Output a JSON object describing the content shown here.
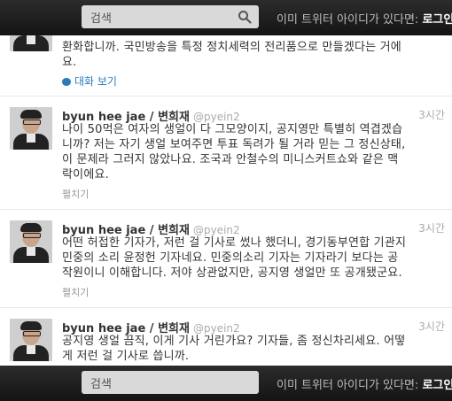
{
  "topbar": {
    "search_placeholder": "검색",
    "signin_prompt": "이미 트위터 아이디가 있다면:",
    "signin_link": "로그인"
  },
  "partial_tweet": {
    "text_line1": "환화합니까. 국민방송을 특정 정치세력의 전리품으로 만들겠다는 거에",
    "text_line2": "요.",
    "conversation_link": "대화 보기"
  },
  "tweets": [
    {
      "name": "byun hee jae / 변희재",
      "handle": "@pyein2",
      "time": "3시간",
      "lines": [
        "나이 50먹은 여자의 생얼이 다 그모양이지, 공지영만 특별히 역겹겠습",
        "니까? 저는 자기 생얼 보여주면 투표 독려가 될 거라 믿는 그 정신상태,",
        "이 문제라 그러지 않았나요. 조국과 안철수의 미니스커트쇼와 같은 맥",
        "락이에요."
      ],
      "expand": "펼치기"
    },
    {
      "name": "byun hee jae / 변희재",
      "handle": "@pyein2",
      "time": "3시간",
      "lines": [
        "어떤 허접한 기자가, 저런 걸 기사로 썼나 했더니, 경기동부연합 기관지",
        "민중의 소리 윤정헌 기자네요. 민중의소리 기자는 기자라기 보다는 공",
        "작원이니 이해합니다. 저야 상관없지만, 공지영 생얼만 또 공개됐군요."
      ],
      "expand": "펼치기"
    },
    {
      "name": "byun hee jae / 변희재",
      "handle": "@pyein2",
      "time": "3시간",
      "lines": [
        "공지영 생얼 끔직, 이게 기사 거린가요? 기자들, 좀 정신차리세요. 어떻",
        "게 저런 걸 기사로 씁니까."
      ],
      "expand": ""
    }
  ],
  "colors": {
    "topbar": "#1b1b1b",
    "link": "#2b7bb9",
    "meta": "#aaaaaa"
  }
}
